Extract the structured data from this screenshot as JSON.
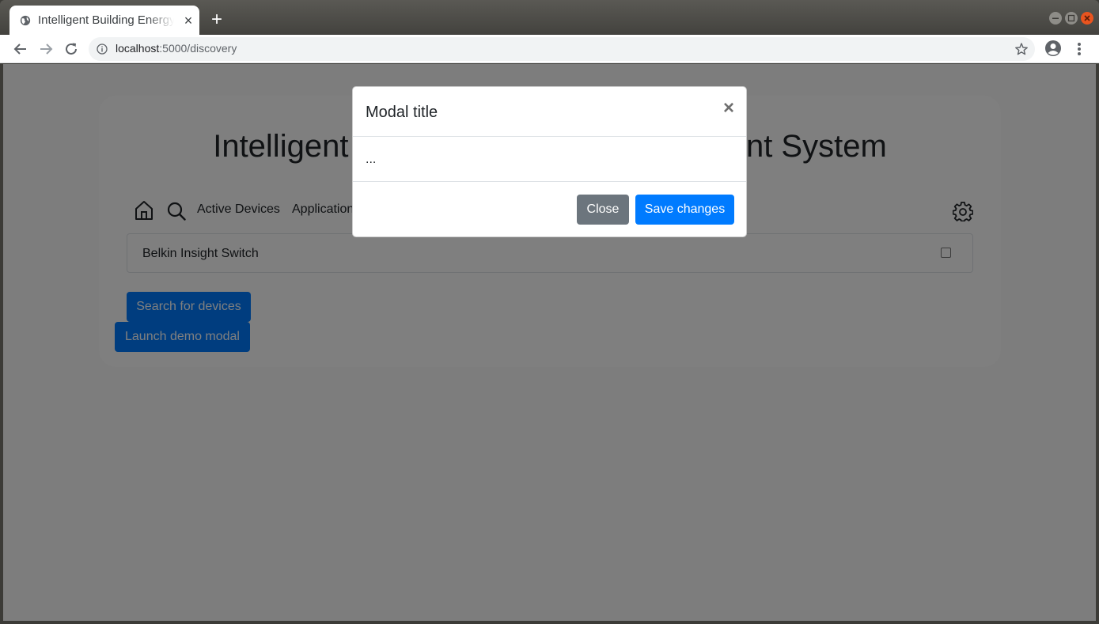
{
  "browser": {
    "tab_title": "Intelligent Building Energy Management System",
    "tab_close": "×",
    "new_tab": "+",
    "url_host": "localhost",
    "url_path": ":5000/discovery"
  },
  "page": {
    "heading": "Intelligent Building Energy Management System",
    "nav": {
      "icons": [
        "home-icon",
        "search-icon",
        "gear-icon"
      ],
      "links": [
        "Active Devices",
        "Applications"
      ]
    },
    "devices": [
      {
        "name": "Belkin Insight Switch",
        "selected": false
      }
    ],
    "search_button": "Search for devices",
    "launch_modal_button": "Launch demo modal"
  },
  "modal": {
    "title": "Modal title",
    "close_symbol": "×",
    "body": "...",
    "close_button": "Close",
    "save_button": "Save changes"
  },
  "colors": {
    "primary": "#007bff",
    "secondary": "#6c757d",
    "backdrop": "rgba(0,0,0,0.5)",
    "window_close": "#e9541f"
  }
}
